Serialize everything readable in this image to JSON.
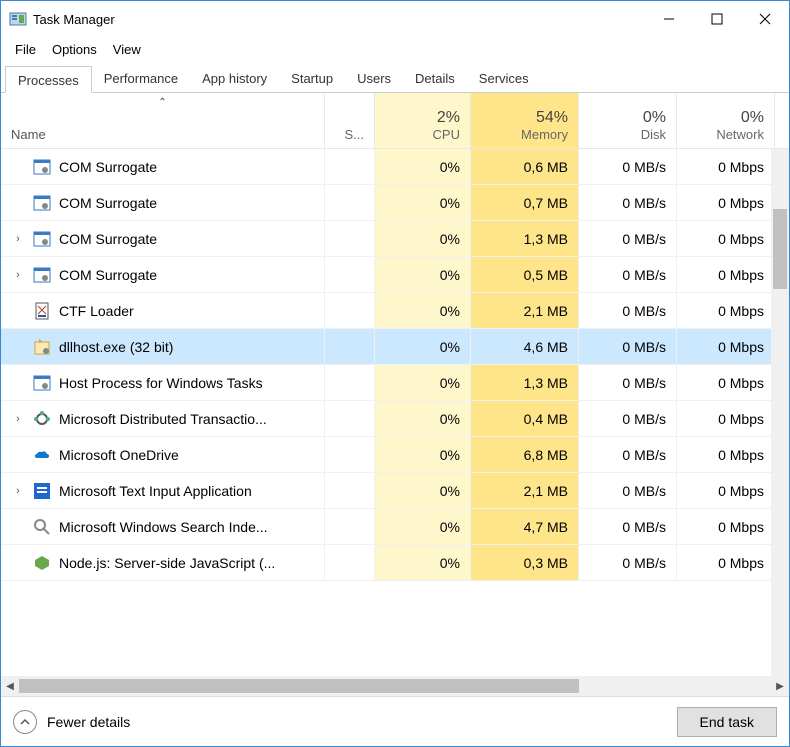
{
  "window": {
    "title": "Task Manager"
  },
  "menu": {
    "file": "File",
    "options": "Options",
    "view": "View"
  },
  "tabs": {
    "processes": "Processes",
    "performance": "Performance",
    "app_history": "App history",
    "startup": "Startup",
    "users": "Users",
    "details": "Details",
    "services": "Services"
  },
  "columns": {
    "name": "Name",
    "status": "S...",
    "cpu": {
      "pct": "2%",
      "label": "CPU"
    },
    "memory": {
      "pct": "54%",
      "label": "Memory"
    },
    "disk": {
      "pct": "0%",
      "label": "Disk"
    },
    "network": {
      "pct": "0%",
      "label": "Network"
    }
  },
  "rows": [
    {
      "expandable": false,
      "icon": "gear-window",
      "name": "COM Surrogate",
      "cpu": "0%",
      "mem": "0,6 MB",
      "disk": "0 MB/s",
      "net": "0 Mbps"
    },
    {
      "expandable": false,
      "icon": "gear-window",
      "name": "COM Surrogate",
      "cpu": "0%",
      "mem": "0,7 MB",
      "disk": "0 MB/s",
      "net": "0 Mbps"
    },
    {
      "expandable": true,
      "icon": "gear-window",
      "name": "COM Surrogate",
      "cpu": "0%",
      "mem": "1,3 MB",
      "disk": "0 MB/s",
      "net": "0 Mbps"
    },
    {
      "expandable": true,
      "icon": "gear-window",
      "name": "COM Surrogate",
      "cpu": "0%",
      "mem": "0,5 MB",
      "disk": "0 MB/s",
      "net": "0 Mbps"
    },
    {
      "expandable": false,
      "icon": "ctf",
      "name": "CTF Loader",
      "cpu": "0%",
      "mem": "2,1 MB",
      "disk": "0 MB/s",
      "net": "0 Mbps"
    },
    {
      "expandable": false,
      "icon": "dllhost",
      "name": "dllhost.exe (32 bit)",
      "cpu": "0%",
      "mem": "4,6 MB",
      "disk": "0 MB/s",
      "net": "0 Mbps",
      "selected": true
    },
    {
      "expandable": false,
      "icon": "gear-window",
      "name": "Host Process for Windows Tasks",
      "cpu": "0%",
      "mem": "1,3 MB",
      "disk": "0 MB/s",
      "net": "0 Mbps"
    },
    {
      "expandable": true,
      "icon": "dtc",
      "name": "Microsoft Distributed Transactio...",
      "cpu": "0%",
      "mem": "0,4 MB",
      "disk": "0 MB/s",
      "net": "0 Mbps"
    },
    {
      "expandable": false,
      "icon": "onedrive",
      "name": "Microsoft OneDrive",
      "cpu": "0%",
      "mem": "6,8 MB",
      "disk": "0 MB/s",
      "net": "0 Mbps"
    },
    {
      "expandable": true,
      "icon": "textinput",
      "name": "Microsoft Text Input Application",
      "cpu": "0%",
      "mem": "2,1 MB",
      "disk": "0 MB/s",
      "net": "0 Mbps"
    },
    {
      "expandable": false,
      "icon": "search",
      "name": "Microsoft Windows Search Inde...",
      "cpu": "0%",
      "mem": "4,7 MB",
      "disk": "0 MB/s",
      "net": "0 Mbps"
    },
    {
      "expandable": false,
      "icon": "node",
      "name": "Node.js: Server-side JavaScript (...",
      "cpu": "0%",
      "mem": "0,3 MB",
      "disk": "0 MB/s",
      "net": "0 Mbps"
    }
  ],
  "footer": {
    "fewer": "Fewer details",
    "endtask": "End task"
  }
}
